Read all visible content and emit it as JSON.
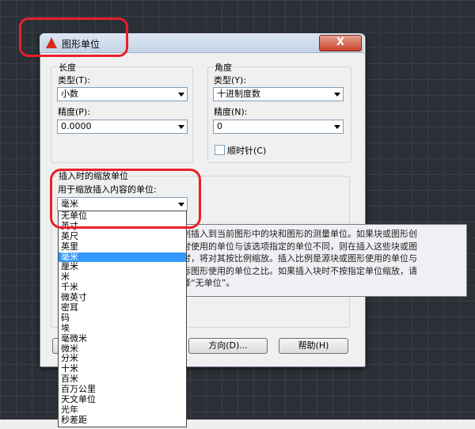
{
  "dialog": {
    "title": "图形单位",
    "close_label": "X"
  },
  "length": {
    "group_label": "长度",
    "type_label": "类型(T):",
    "type_value": "小数",
    "precision_label": "精度(P):",
    "precision_value": "0.0000"
  },
  "angle": {
    "group_label": "角度",
    "type_label": "类型(Y):",
    "type_value": "十进制度数",
    "precision_label": "精度(N):",
    "precision_value": "0",
    "clockwise_label": "顺时针(C)"
  },
  "insertion": {
    "group_label": "插入时的缩放单位",
    "units_label": "用于缩放插入内容的单位:",
    "units_value": "毫米",
    "options": [
      "无单位",
      "英寸",
      "英尺",
      "英里",
      "毫米",
      "厘米",
      "米",
      "千米",
      "微英寸",
      "密耳",
      "码",
      "埃",
      "毫微米",
      "微米",
      "分米",
      "十米",
      "百米",
      "百万公里",
      "天文单位",
      "光年",
      "秒差距"
    ],
    "selected_index": 4
  },
  "tooltip": {
    "lines": [
      "控制插入到当前图形中的块和图形的测量单位。如果块或图形创",
      "建时使用的单位与该选项指定的单位不同，则在插入这些块或图",
      "形时，将对其按比例缩放。插入比例是源块或图形使用的单位与",
      "目标图形使用的单位之比。如果插入块时不按指定单位缩放，请",
      "选择“无单位”。"
    ]
  },
  "buttons": {
    "direction_label": "方向(D)...",
    "help_label": "帮助(H)"
  },
  "colors": {
    "highlight": "#3399ff",
    "annotation": "#e8202a"
  }
}
